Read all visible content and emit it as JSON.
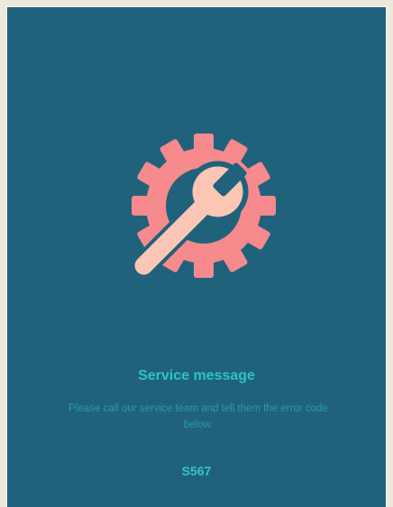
{
  "screen": {
    "icon": "gear-wrench-icon",
    "title": "Service message",
    "message": "Please call our service team and tell them the error code below.",
    "error_code": "S567"
  },
  "colors": {
    "background": "#20627b",
    "gear": "#f68a8d",
    "wrench": "#fbc6b4",
    "accent_text": "#2fc2cc"
  }
}
